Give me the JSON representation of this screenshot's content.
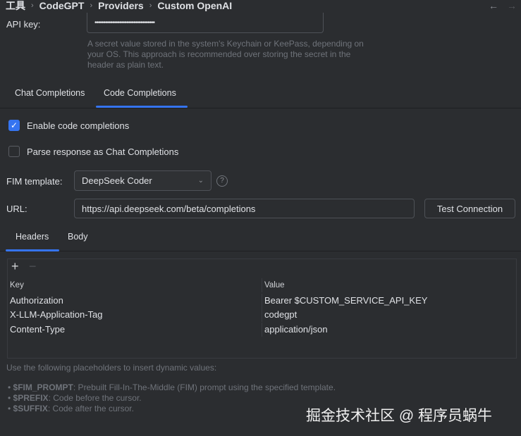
{
  "breadcrumb": [
    "工具",
    "CodeGPT",
    "Providers",
    "Custom OpenAI"
  ],
  "nav": {
    "back": "←",
    "forward": "→"
  },
  "api_key": {
    "label": "API key:",
    "value": "••••••••••••••••••••••••••••••••••",
    "hint": "A secret value stored in the system's Keychain or KeePass, depending on your OS. This approach is recommended over storing the secret in the header as plain text."
  },
  "tabs": [
    "Chat Completions",
    "Code Completions"
  ],
  "enable_code_completions": {
    "label": "Enable code completions",
    "checked": true
  },
  "parse_response": {
    "label": "Parse response as Chat Completions",
    "checked": false
  },
  "fim": {
    "label": "FIM template:",
    "value": "DeepSeek Coder",
    "help": "?"
  },
  "url": {
    "label": "URL:",
    "value": "https://api.deepseek.com/beta/completions"
  },
  "test_button": "Test Connection",
  "subtabs": [
    "Headers",
    "Body"
  ],
  "toolbar": {
    "add": "+",
    "remove": "−"
  },
  "table": {
    "headers": [
      "Key",
      "Value"
    ],
    "rows": [
      [
        "Authorization",
        "Bearer $CUSTOM_SERVICE_API_KEY"
      ],
      [
        "X-LLM-Application-Tag",
        "codegpt"
      ],
      [
        "Content-Type",
        "application/json"
      ]
    ]
  },
  "placeholders": {
    "intro": "Use the following placeholders to insert dynamic values:",
    "items": [
      {
        "name": "$FIM_PROMPT",
        "desc": ": Prebuilt Fill-In-The-Middle (FIM) prompt using the specified template."
      },
      {
        "name": "$PREFIX",
        "desc": ": Code before the cursor."
      },
      {
        "name": "$SUFFIX",
        "desc": ": Code after the cursor."
      }
    ]
  },
  "watermark": "掘金技术社区 @ 程序员蜗牛"
}
